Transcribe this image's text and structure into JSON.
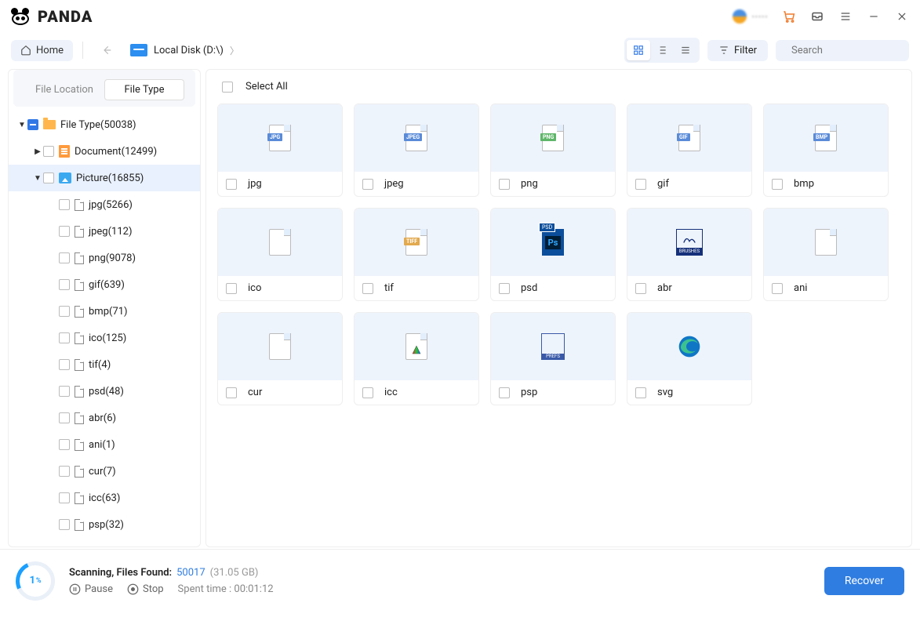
{
  "app": {
    "name": "PANDA"
  },
  "titlebar_user": "·····",
  "toolbar": {
    "home": "Home",
    "breadcrumb": "Local Disk (D:\\)",
    "filter": "Filter",
    "search_placeholder": "Search"
  },
  "sidebar": {
    "tabs": {
      "location": "File Location",
      "type": "File Type",
      "active": "type"
    },
    "root": {
      "label": "File Type(50038)"
    },
    "document": {
      "label": "Document(12499)"
    },
    "picture": {
      "label": "Picture(16855)"
    },
    "picture_children": [
      {
        "label": "jpg(5266)"
      },
      {
        "label": "jpeg(112)"
      },
      {
        "label": "png(9078)"
      },
      {
        "label": "gif(639)"
      },
      {
        "label": "bmp(71)"
      },
      {
        "label": "ico(125)"
      },
      {
        "label": "tif(4)"
      },
      {
        "label": "psd(48)"
      },
      {
        "label": "abr(6)"
      },
      {
        "label": "ani(1)"
      },
      {
        "label": "cur(7)"
      },
      {
        "label": "icc(63)"
      },
      {
        "label": "psp(32)"
      }
    ]
  },
  "main": {
    "select_all": "Select All",
    "items": [
      {
        "label": "jpg",
        "tag": "JPG",
        "color": "#5a8bd8"
      },
      {
        "label": "jpeg",
        "tag": "JPEG",
        "color": "#5a8bd8"
      },
      {
        "label": "png",
        "tag": "PNG",
        "color": "#5fb66a"
      },
      {
        "label": "gif",
        "tag": "GIF",
        "color": "#5a8bd8"
      },
      {
        "label": "bmp",
        "tag": "BMP",
        "color": "#5a8bd8"
      },
      {
        "label": "ico",
        "tag": "",
        "color": ""
      },
      {
        "label": "tif",
        "tag": "TIFF",
        "color": "#e2a94e"
      },
      {
        "label": "psd",
        "tag": "PSD",
        "color": "#0b4e9b"
      },
      {
        "label": "abr",
        "tag": "",
        "color": "#15307a"
      },
      {
        "label": "ani",
        "tag": "",
        "color": ""
      },
      {
        "label": "cur",
        "tag": "",
        "color": ""
      },
      {
        "label": "icc",
        "tag": "",
        "color": ""
      },
      {
        "label": "psp",
        "tag": "",
        "color": "#3a5aa8"
      },
      {
        "label": "svg",
        "tag": "",
        "color": ""
      }
    ]
  },
  "status": {
    "percent": "1",
    "pct_suffix": "%",
    "scanning": "Scanning, Files Found:",
    "count": "50017",
    "size": "(31.05 GB)",
    "pause": "Pause",
    "stop": "Stop",
    "spent": "Spent time : 00:01:12",
    "recover": "Recover"
  }
}
